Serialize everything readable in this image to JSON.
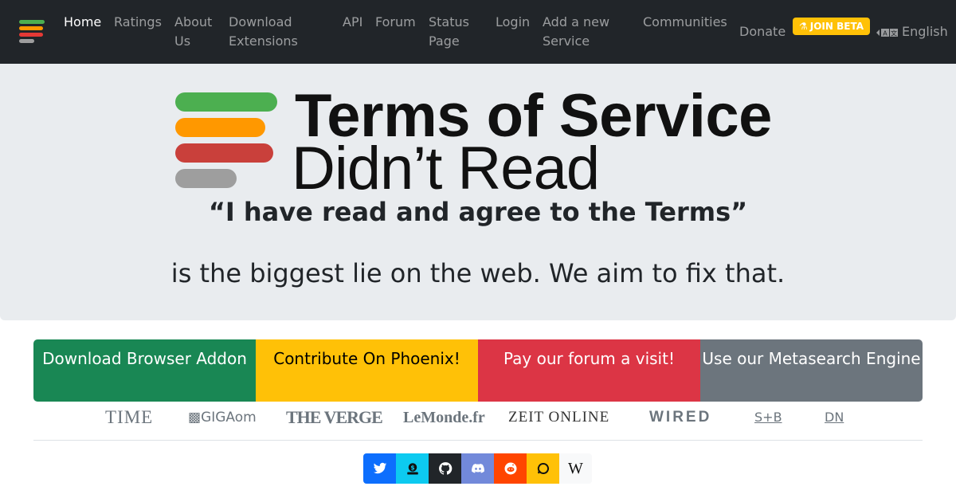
{
  "nav": {
    "items": [
      {
        "label": "Home",
        "active": true
      },
      {
        "label": "Ratings"
      },
      {
        "label": "About Us"
      },
      {
        "label": "Download Extensions"
      },
      {
        "label": "API"
      },
      {
        "label": "Forum"
      },
      {
        "label": "Status Page"
      },
      {
        "label": "Login"
      },
      {
        "label": "Add a new Service"
      },
      {
        "label": "Communities"
      },
      {
        "label": "Donate"
      }
    ],
    "beta_badge": "JOIN BETA",
    "language": "English"
  },
  "hero": {
    "brand_line1": "Terms of Service",
    "brand_line2": "Didn’t Read",
    "quote": "“I have read and agree to the Terms”",
    "tagline": "is the biggest lie on the web. We aim to fix that."
  },
  "actions": [
    {
      "label": "Download Browser Addon"
    },
    {
      "label": "Contribute On Phoenix!"
    },
    {
      "label": "Pay our forum a visit!"
    },
    {
      "label": "Use our Metasearch Engine"
    }
  ],
  "press": {
    "time": "TIME",
    "gigaom": "GIGAom",
    "verge": "THE VERGE",
    "lemonde": "LeMonde.fr",
    "zeit": "ZEIT ONLINE",
    "wired": "WIRED",
    "sb": "S+B",
    "dn": "DN"
  },
  "social": [
    {
      "icon": "twitter-icon",
      "color": "#0d6efd"
    },
    {
      "icon": "donate-icon",
      "color": "#0dcaf0"
    },
    {
      "icon": "github-icon",
      "color": "#212529"
    },
    {
      "icon": "discord-icon",
      "color": "#7289da"
    },
    {
      "icon": "reddit-icon",
      "color": "#ff4500"
    },
    {
      "icon": "matrix-chat-icon",
      "color": "#ffc107"
    },
    {
      "icon": "wikipedia-icon",
      "color": "#f8f9fa"
    }
  ],
  "colors": {
    "navbar": "#212529",
    "hero_bg": "#e9ecef",
    "logo_green": "#4caf50",
    "logo_orange": "#ff9800",
    "logo_red": "#c9403b",
    "logo_gray": "#9e9e9e"
  }
}
